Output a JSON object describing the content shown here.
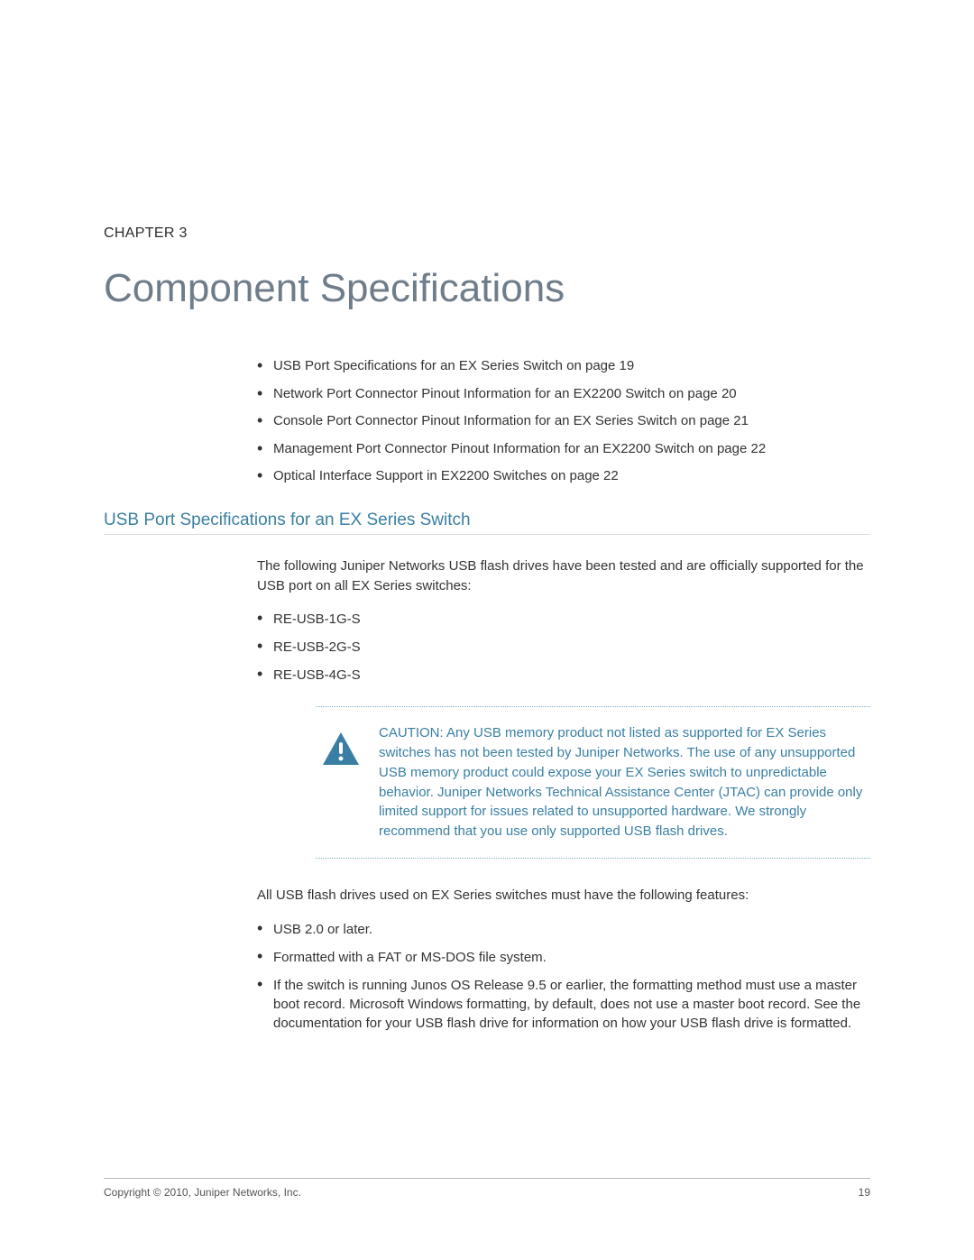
{
  "chapter": {
    "label": "CHAPTER 3",
    "title": "Component Specifications"
  },
  "toc": [
    "USB Port Specifications for an EX Series Switch on page 19",
    "Network Port Connector Pinout Information for an EX2200 Switch on page 20",
    "Console Port Connector Pinout Information for an EX Series Switch on page 21",
    "Management Port Connector Pinout Information for an EX2200 Switch on page 22",
    "Optical Interface Support in EX2200 Switches on page 22"
  ],
  "section": {
    "heading": "USB Port Specifications for an EX Series Switch",
    "intro": "The following Juniper Networks USB flash drives have been tested and are officially supported for the USB port on all EX Series switches:",
    "usb_models": [
      "RE-USB-1G-S",
      "RE-USB-2G-S",
      "RE-USB-4G-S"
    ],
    "caution": "CAUTION:  Any USB memory product not listed as supported for EX Series switches has not been tested by Juniper Networks. The use of any unsupported USB memory product could expose your EX Series switch to unpredictable behavior. Juniper Networks Technical Assistance Center (JTAC) can provide only limited support for issues related to unsupported hardware. We strongly recommend that you use only supported USB flash drives.",
    "features_intro": "All USB flash drives used on EX Series switches must have the following features:",
    "features": [
      "USB 2.0 or later.",
      "Formatted with a FAT or MS-DOS file system.",
      "If the switch is running Junos OS Release 9.5 or earlier, the formatting method must use a master boot record. Microsoft Windows formatting, by default, does not use a master boot record. See the documentation for your USB flash drive for information on how your USB flash drive is formatted."
    ]
  },
  "footer": {
    "copyright": "Copyright © 2010, Juniper Networks, Inc.",
    "page": "19"
  }
}
